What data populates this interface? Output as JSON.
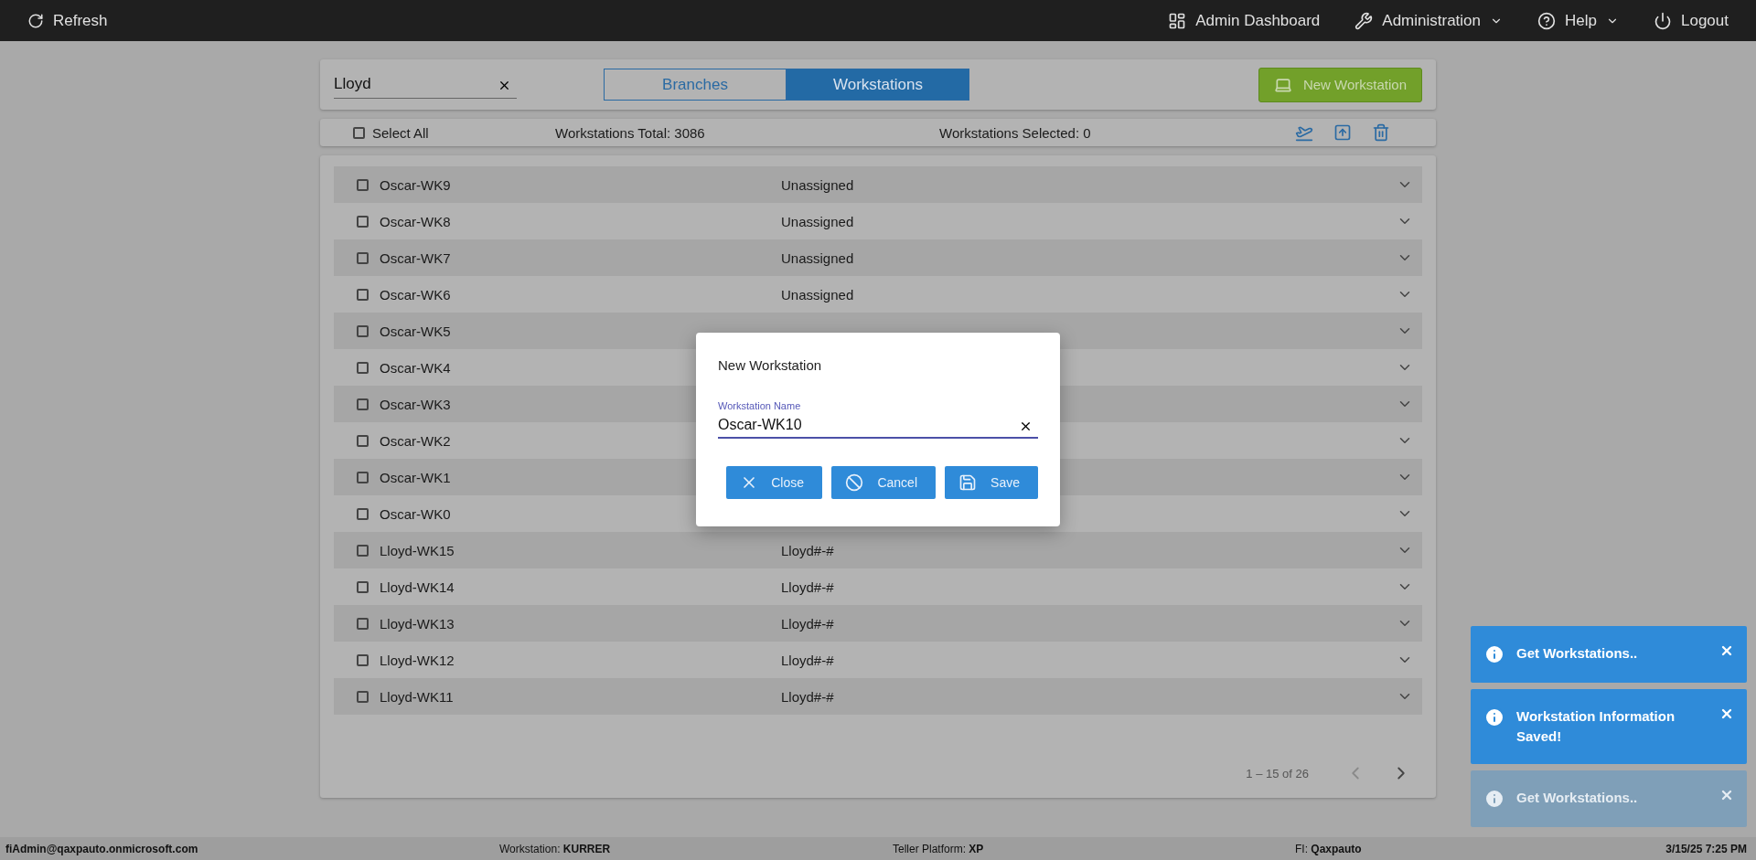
{
  "top_bar": {
    "refresh": "Refresh",
    "menu": [
      {
        "kind": "dashboard",
        "label": "Admin Dashboard",
        "dropdown": false
      },
      {
        "kind": "admin",
        "label": "Administration",
        "dropdown": true
      },
      {
        "kind": "help",
        "label": "Help",
        "dropdown": true
      },
      {
        "kind": "logout",
        "label": "Logout",
        "dropdown": false
      }
    ]
  },
  "search": {
    "value": "Lloyd"
  },
  "tabs": [
    {
      "label": "Branches",
      "selected": false
    },
    {
      "label": "Workstations",
      "selected": true
    }
  ],
  "new_button": "New Workstation",
  "toolbar": {
    "select_all": {
      "label": "Select All",
      "checked": false
    },
    "total": "Workstations Total: 3086",
    "selected": "Workstations Selected: 0"
  },
  "rows": [
    {
      "name": "Oscar-WK9",
      "branch": "Unassigned",
      "checked": false
    },
    {
      "name": "Oscar-WK8",
      "branch": "Unassigned",
      "checked": false
    },
    {
      "name": "Oscar-WK7",
      "branch": "Unassigned",
      "checked": false
    },
    {
      "name": "Oscar-WK6",
      "branch": "Unassigned",
      "checked": false
    },
    {
      "name": "Oscar-WK5",
      "checked": false
    },
    {
      "name": "Oscar-WK4",
      "checked": false
    },
    {
      "name": "Oscar-WK3",
      "checked": false
    },
    {
      "name": "Oscar-WK2",
      "checked": false
    },
    {
      "name": "Oscar-WK1",
      "checked": false
    },
    {
      "name": "Oscar-WK0",
      "checked": false
    },
    {
      "name": "Lloyd-WK15",
      "branch": "Lloyd#-#",
      "checked": false
    },
    {
      "name": "Lloyd-WK14",
      "branch": "Lloyd#-#",
      "checked": false
    },
    {
      "name": "Lloyd-WK13",
      "branch": "Lloyd#-#",
      "checked": false
    },
    {
      "name": "Lloyd-WK12",
      "branch": "Lloyd#-#",
      "checked": false
    },
    {
      "name": "Lloyd-WK11",
      "branch": "Lloyd#-#",
      "checked": false
    }
  ],
  "pagination": {
    "range": "1 – 15 of 26",
    "prev_disabled": true,
    "next_disabled": false
  },
  "dialog": {
    "title": "New Workstation",
    "field_label": "Workstation Name",
    "field_value": "Oscar-WK10",
    "buttons": [
      {
        "kind": "close",
        "label": "Close"
      },
      {
        "kind": "cancel",
        "label": "Cancel"
      },
      {
        "kind": "save",
        "label": "Save"
      }
    ]
  },
  "toasts": [
    {
      "text": "Get Workstations..",
      "faded": false
    },
    {
      "text": "Workstation Information Saved!",
      "faded": false
    },
    {
      "text": "Get Workstations..",
      "faded": true
    }
  ],
  "status_bar": {
    "user": "fiAdmin@qaxpauto.onmicrosoft.com",
    "items": [
      "Workstation: **KURRER**",
      "Teller Platform: **XP**",
      "FI: **Qaxpauto**"
    ],
    "datetime": "3/15/25 7:25 PM"
  }
}
